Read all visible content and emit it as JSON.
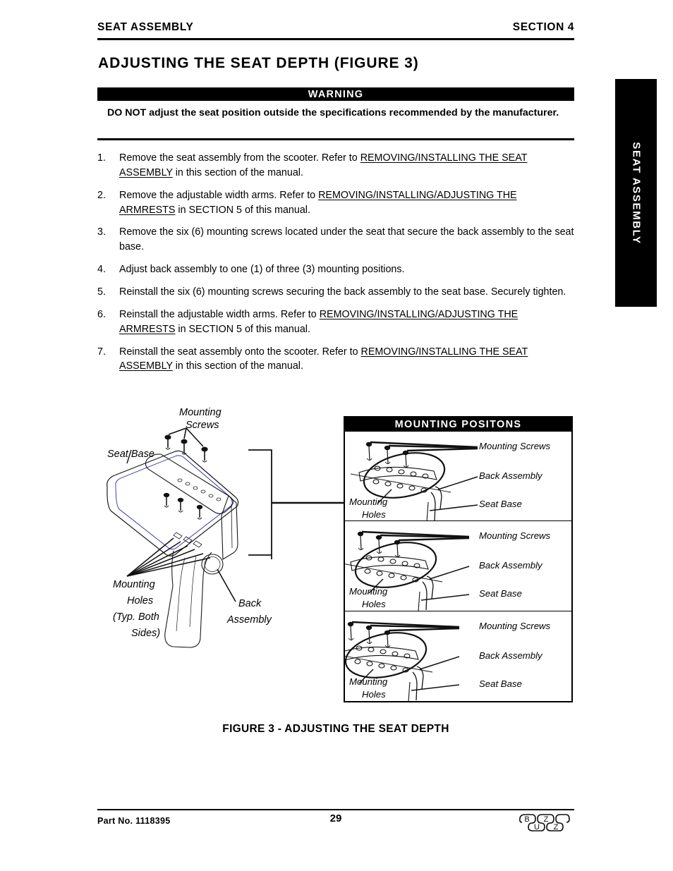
{
  "header": {
    "left_title": "SEAT ASSEMBLY",
    "right_title": "SECTION 4"
  },
  "heading": "ADJUSTING THE SEAT DEPTH (FIGURE 3)",
  "warning": {
    "bar_label": "WARNING",
    "body_bold_lead": "DO NOT",
    "body_rest": " adjust the seat position outside the specifications recommended by the manufacturer."
  },
  "steps": [
    {
      "num": "1.",
      "parts": [
        {
          "text": "Remove the seat assembly from the scooter. Refer to ",
          "underline": false
        },
        {
          "text": "REMOVING/INSTALLING THE SEAT ASSEMBLY",
          "underline": true
        },
        {
          "text": " in this section of the manual.",
          "underline": false
        }
      ]
    },
    {
      "num": "2.",
      "parts": [
        {
          "text": "Remove the adjustable width arms. Refer to ",
          "underline": false
        },
        {
          "text": "REMOVING/INSTALLING/ADJUSTING THE ARMRESTS",
          "underline": true
        },
        {
          "text": "  in SECTION 5 of this manual.",
          "underline": false
        }
      ]
    },
    {
      "num": "3.",
      "parts": [
        {
          "text": "Remove the six (6) mounting screws located under the seat that secure the back assembly to the seat base.",
          "underline": false
        }
      ]
    },
    {
      "num": "4.",
      "parts": [
        {
          "text": "Adjust back assembly to one (1) of three (3) mounting positions.",
          "underline": false
        }
      ]
    },
    {
      "num": "5.",
      "parts": [
        {
          "text": "Reinstall the six (6) mounting screws securing the back assembly to the seat base. Securely tighten.",
          "underline": false
        }
      ]
    },
    {
      "num": "6.",
      "parts": [
        {
          "text": "Reinstall the adjustable width arms. Refer to ",
          "underline": false
        },
        {
          "text": "REMOVING/INSTALLING/ADJUSTING THE ARMRESTS",
          "underline": true
        },
        {
          "text": "  in SECTION 5 of this manual.",
          "underline": false
        }
      ]
    },
    {
      "num": "7.",
      "parts": [
        {
          "text": "Reinstall the seat assembly onto the scooter. Refer to ",
          "underline": false
        },
        {
          "text": "REMOVING/INSTALLING THE SEAT ASSEMBLY",
          "underline": true
        },
        {
          "text": " in this section of the manual.",
          "underline": false
        }
      ]
    }
  ],
  "side_tab": {
    "label": "SEAT ASSEMBLY"
  },
  "figure": {
    "caption": "FIGURE 3 - ADJUSTING THE SEAT DEPTH",
    "left_diagram": {
      "labels": {
        "seat_base": "Seat Base",
        "mounting_screws_line1": "Mounting",
        "mounting_screws_line2": "Screws",
        "mounting_holes_line1": "Mounting",
        "mounting_holes_line2": "Holes",
        "mounting_holes_line3": "(Typ. Both",
        "mounting_holes_line4": "Sides)",
        "back_assembly_line1": "Back",
        "back_assembly_line2": "Assembly"
      }
    },
    "mounting_positions_box": {
      "title": "MOUNTING POSITONS",
      "panels": [
        {
          "mounting_screws": "Mounting  Screws",
          "back_assembly": "Back  Assembly",
          "seat_base": "Seat Base",
          "mounting_holes_line1": "Mounting",
          "mounting_holes_line2": "Holes"
        },
        {
          "mounting_screws": "Mounting  Screws",
          "back_assembly": "Back  Assembly",
          "seat_base": "Seat Base",
          "mounting_holes_line1": "Mounting",
          "mounting_holes_line2": "Holes"
        },
        {
          "mounting_screws": "Mounting  Screws",
          "back_assembly": "Back  Assembly",
          "seat_base": "Seat Base",
          "mounting_holes_line1": "Mounting",
          "mounting_holes_line2": "Holes"
        }
      ]
    }
  },
  "footer": {
    "part_no": "Part No. 1118395",
    "page_number": "29",
    "logo_letters": [
      "B",
      "U",
      "Z",
      "Z"
    ]
  }
}
